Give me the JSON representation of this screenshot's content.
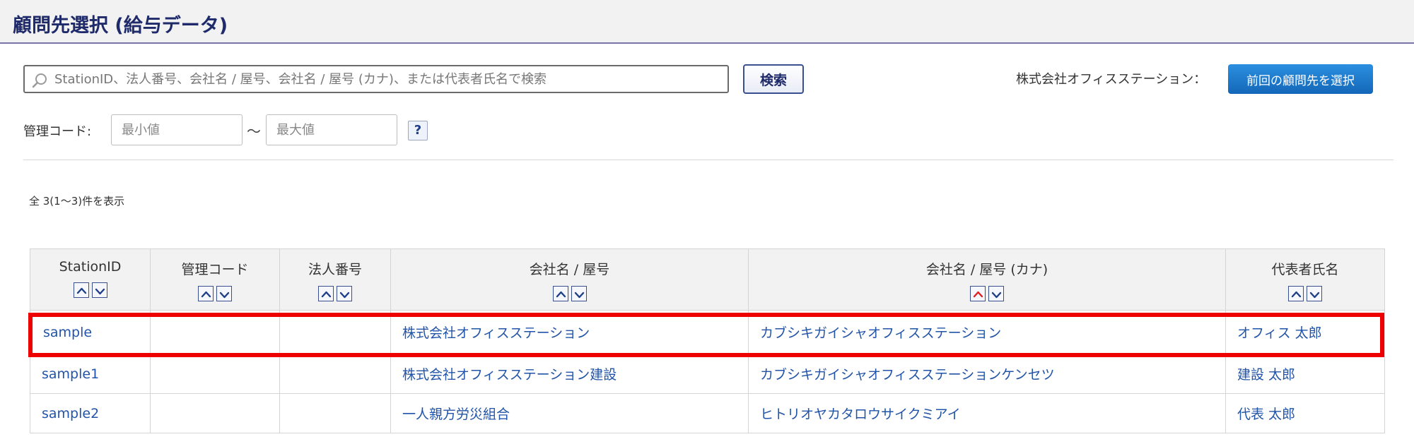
{
  "header": {
    "title": "顧問先選択 (給与データ)"
  },
  "search": {
    "placeholder": "StationID、法人番号、会社名 / 屋号、会社名 / 屋号 (カナ)、または代表者氏名で検索",
    "button_label": "検索"
  },
  "previous_client": {
    "label": "株式会社オフィスステーション：",
    "button_label": "前回の顧問先を選択"
  },
  "code_filter": {
    "label": "管理コード:",
    "min_placeholder": "最小値",
    "separator": "～",
    "max_placeholder": "最大値",
    "help_label": "?"
  },
  "result_count": "全 3(1～3)件を表示",
  "table": {
    "columns": [
      {
        "label": "StationID",
        "active_sort": "none"
      },
      {
        "label": "管理コード",
        "active_sort": "none"
      },
      {
        "label": "法人番号",
        "active_sort": "none"
      },
      {
        "label": "会社名 / 屋号",
        "active_sort": "none"
      },
      {
        "label": "会社名 / 屋号 (カナ)",
        "active_sort": "asc"
      },
      {
        "label": "代表者氏名",
        "active_sort": "none"
      }
    ],
    "rows": [
      {
        "station_id": "sample",
        "code": "",
        "corp_number": "",
        "company": "株式会社オフィスステーション",
        "company_kana": "カブシキガイシャオフィスステーション",
        "representative": "オフィス 太郎",
        "highlighted": true
      },
      {
        "station_id": "sample1",
        "code": "",
        "corp_number": "",
        "company": "株式会社オフィスステーション建設",
        "company_kana": "カブシキガイシャオフィスステーションケンセツ",
        "representative": "建設 太郎",
        "highlighted": false
      },
      {
        "station_id": "sample2",
        "code": "",
        "corp_number": "",
        "company": "一人親方労災組合",
        "company_kana": "ヒトリオヤカタロウサイクミアイ",
        "representative": "代表 太郎",
        "highlighted": false
      }
    ]
  },
  "colors": {
    "title": "#1f2a6b",
    "link": "#2154a8",
    "primary_button": "#1a73c8",
    "highlight": "#ee0000",
    "active_sort_arrow": "#e02020"
  },
  "icons": {
    "search": "search-icon",
    "sort_asc": "chevron-up-icon",
    "sort_desc": "chevron-down-icon"
  }
}
